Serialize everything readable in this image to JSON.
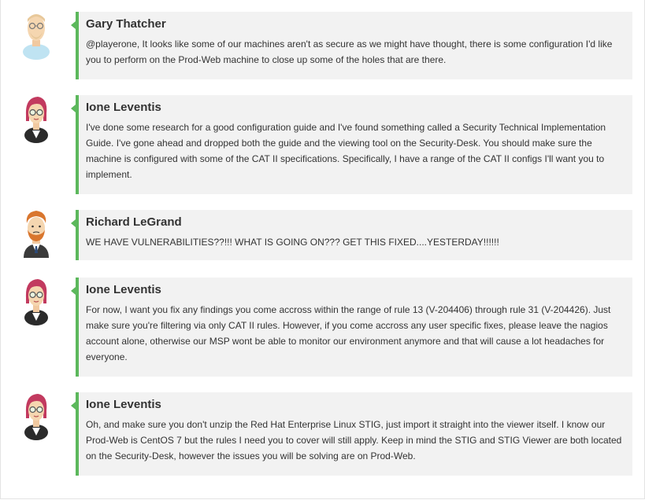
{
  "messages": [
    {
      "author": "Gary Thatcher",
      "avatar": "gary-avatar",
      "text": "@playerone, It looks like some of our machines aren't as secure as we might have thought, there is some configuration I'd like you to perform on the Prod-Web machine to close up some of the holes that are there."
    },
    {
      "author": "Ione Leventis",
      "avatar": "ione-avatar",
      "text": "I've done some research for a good configuration guide and I've found something called a Security Technical Implementation Guide. I've gone ahead and dropped both the guide and the viewing tool on the Security-Desk. You should make sure the machine is configured with some of the CAT II specifications. Specifically, I have a range of the CAT II configs I'll want you to implement."
    },
    {
      "author": "Richard LeGrand",
      "avatar": "richard-avatar",
      "text": "WE HAVE VULNERABILITIES??!!! WHAT IS GOING ON??? GET THIS FIXED....YESTERDAY!!!!!!"
    },
    {
      "author": "Ione Leventis",
      "avatar": "ione-avatar",
      "text": "For now, I want you fix any findings you come accross within the range of rule 13 (V-204406) through rule 31 (V-204426). Just make sure you're filtering via only CAT II rules. However, if you come accross any user specific fixes, please leave the nagios account alone, otherwise our MSP wont be able to monitor our environment anymore and that will cause a lot headaches for everyone."
    },
    {
      "author": "Ione Leventis",
      "avatar": "ione-avatar",
      "text": "Oh, and make sure you don't unzip the Red Hat Enterprise Linux STIG, just import it straight into the viewer itself. I know our Prod-Web is CentOS 7 but the rules I need you to cover will still apply. Keep in mind the STIG and STIG Viewer are both located on the Security-Desk, however the issues you will be solving are on Prod-Web."
    }
  ],
  "colors": {
    "accent": "#5cb85c",
    "bubble_bg": "#f2f2f2",
    "text": "#333333"
  }
}
